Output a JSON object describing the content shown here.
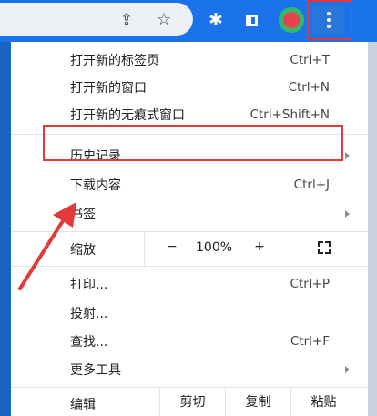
{
  "toolbar": {
    "icons": [
      "share-icon",
      "star-icon",
      "puzzle-icon",
      "tab-icon",
      "profile-icon",
      "kebab-icon"
    ]
  },
  "menu": {
    "new_tab": {
      "label": "打开新的标签页",
      "shortcut": "Ctrl+T"
    },
    "new_window": {
      "label": "打开新的窗口",
      "shortcut": "Ctrl+N"
    },
    "new_incognito": {
      "label": "打开新的无痕式窗口",
      "shortcut": "Ctrl+Shift+N"
    },
    "history": {
      "label": "历史记录"
    },
    "downloads": {
      "label": "下载内容",
      "shortcut": "Ctrl+J"
    },
    "bookmarks": {
      "label": "书签"
    },
    "zoom": {
      "label": "缩放",
      "minus": "−",
      "value": "100%",
      "plus": "+"
    },
    "print": {
      "label": "打印...",
      "shortcut": "Ctrl+P"
    },
    "cast": {
      "label": "投射..."
    },
    "find": {
      "label": "查找...",
      "shortcut": "Ctrl+F"
    },
    "more_tools": {
      "label": "更多工具"
    },
    "edit": {
      "label": "编辑",
      "cut": "剪切",
      "copy": "复制",
      "paste": "粘贴"
    }
  },
  "colors": {
    "toolbar_bg": "#1a73e8",
    "annotation": "#e03a3a"
  }
}
